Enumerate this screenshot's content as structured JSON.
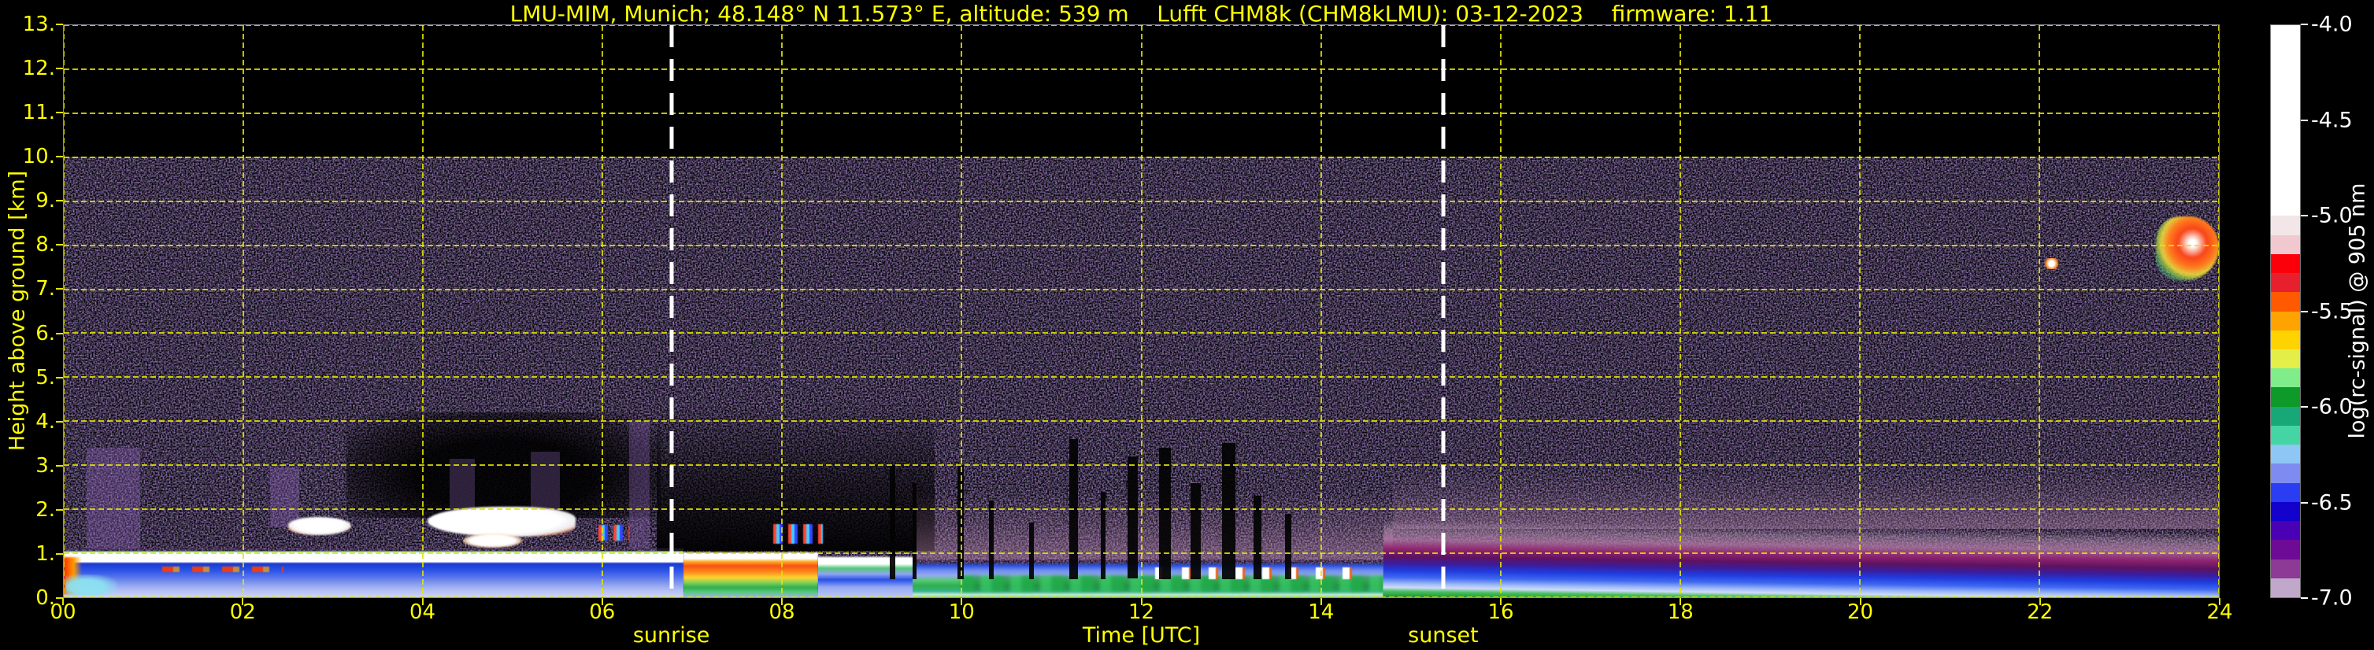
{
  "chart_data": {
    "type": "heatmap",
    "title": "LMU-MIM, Munich; 48.148° N 11.573° E, altitude: 539 m    Lufft CHM8k (CHM8kLMU): 03-12-2023    firmware: 1.11",
    "instrument": "Lufft CHM8k (CHM8kLMU)",
    "date": "03-12-2023",
    "firmware": "1.11",
    "x_axis": {
      "label": "Time [UTC]",
      "range": [
        0,
        24
      ],
      "tick_values": [
        0,
        2,
        4,
        6,
        8,
        10,
        12,
        14,
        16,
        18,
        20,
        22,
        24
      ],
      "tick_labels": [
        "00",
        "02",
        "04",
        "06",
        "08",
        "10",
        "12",
        "14",
        "16",
        "18",
        "20",
        "22",
        "24"
      ]
    },
    "y_axis": {
      "label": "Height above ground [km]",
      "range": [
        0,
        13
      ],
      "tick_values": [
        0,
        1,
        2,
        3,
        4,
        5,
        6,
        7,
        8,
        9,
        10,
        11,
        12,
        13
      ],
      "tick_labels": [
        "0.",
        "1.",
        "2.",
        "3.",
        "4.",
        "5.",
        "6.",
        "7.",
        "8.",
        "9.",
        "10.",
        "11.",
        "12.",
        "13."
      ]
    },
    "colorbar": {
      "label": "log(rc-signal) @ 905 nm",
      "range": [
        -7.0,
        -4.0
      ],
      "ticks": [
        {
          "value": -4.0,
          "label": "-4.0"
        },
        {
          "value": -4.5,
          "label": "-4.5"
        },
        {
          "value": -5.0,
          "label": "-5.0"
        },
        {
          "value": -5.5,
          "label": "-5.5"
        },
        {
          "value": -6.0,
          "label": "-6.0"
        },
        {
          "value": -6.5,
          "label": "-6.5"
        },
        {
          "value": -7.0,
          "label": "-7.0"
        }
      ],
      "segment_colors": [
        "#ffffff",
        "#ffffff",
        "#ffffff",
        "#ffffff",
        "#ffffff",
        "#ffffff",
        "#ffffff",
        "#ffffff",
        "#ffffff",
        "#ffffff",
        "#f2e6e8",
        "#f2c8d0",
        "#fb000a",
        "#e8202e",
        "#ff5a00",
        "#ffa300",
        "#ffd300",
        "#e4ee48",
        "#7fee8a",
        "#0e9a28",
        "#18a878",
        "#45d4a4",
        "#8ec6f6",
        "#7e8cf2",
        "#2a3df2",
        "#1202cc",
        "#4a00b4",
        "#6e0b96",
        "#8c3a96",
        "#bfa8ca"
      ]
    },
    "annotations": [
      {
        "name": "sunrise",
        "label": "sunrise",
        "time_utc": 6.77
      },
      {
        "name": "sunset",
        "label": "sunset",
        "time_utc": 15.36
      }
    ],
    "noise": {
      "ceiling_km": 10,
      "description": "purple-blue background noise speckle below 10 km; black (no data) above 10 km; bright multicolor speckle line at ground level"
    },
    "features": [
      {
        "name": "attenuation-shadow-early",
        "x0": 3.15,
        "x1": 6.65,
        "y0": 1.8,
        "y1": 4.2,
        "bg": "radial-gradient(ellipse at 50% 60%, rgba(0,0,0,0.92) 40%, rgba(0,0,0,0.55) 68%, rgba(0,0,0,0) 95%)"
      },
      {
        "name": "attenuation-shadow-fog",
        "x0": 6.6,
        "x1": 9.7,
        "y0": 1.05,
        "y1": 4.4,
        "bg": "linear-gradient(to top, rgba(0,0,0,0.95) 0%, rgba(0,0,0,0.6) 45%, rgba(0,0,0,0) 100%)"
      },
      {
        "name": "haze-speckle-day",
        "x0": 9.5,
        "x1": 14.8,
        "y0": 0.85,
        "y1": 2.4,
        "bg": "linear-gradient(to top, rgba(186,136,176,0.5) 0%, rgba(186,136,176,0.18) 55%, rgba(0,0,0,0) 100%)"
      },
      {
        "name": "haze-speckle-evening",
        "x0": 14.8,
        "x1": 24.05,
        "y0": 1.55,
        "y1": 2.9,
        "bg": "linear-gradient(to top, rgba(186,136,176,0.42) 0%, rgba(186,136,176,0.12) 60%, rgba(0,0,0,0) 100%)"
      },
      {
        "name": "virga-column-1",
        "x0": 0.25,
        "x1": 0.85,
        "y0": 1.1,
        "y1": 3.4,
        "bg": "rgba(135,95,175,0.38)"
      },
      {
        "name": "virga-column-2",
        "x0": 2.3,
        "x1": 2.62,
        "y0": 1.6,
        "y1": 2.95,
        "bg": "rgba(135,95,175,0.38)"
      },
      {
        "name": "virga-column-3",
        "x0": 4.3,
        "x1": 4.58,
        "y0": 2.0,
        "y1": 3.15,
        "bg": "rgba(135,95,175,0.32)"
      },
      {
        "name": "virga-column-4",
        "x0": 5.2,
        "x1": 5.52,
        "y0": 1.95,
        "y1": 3.3,
        "bg": "rgba(135,95,175,0.32)"
      },
      {
        "name": "virga-column-5",
        "x0": 6.3,
        "x1": 6.52,
        "y0": 1.1,
        "y1": 4.0,
        "bg": "rgba(135,95,175,0.35)"
      },
      {
        "name": "morning-boundary-layer",
        "x0": 0,
        "x1": 6.9,
        "y0": 0,
        "y1": 1.1,
        "bg": "linear-gradient(to bottom, rgba(120,50,120,0.45) 0%, rgba(120,50,120,0.12) 4%, #35c56a 6%, #dcf7e6 8%, #ffffff 10%, #ffffff 27%, #1b39cf 31%, #2d55e8 46%, #5c78ea 60%, #8da1f0 74%, #b3bff4 86%, #ccd4f8 100%)"
      },
      {
        "name": "fog-bank",
        "x0": 6.9,
        "x1": 8.4,
        "y0": 0,
        "y1": 1.02,
        "blur": 0.5,
        "bg": "linear-gradient(to bottom, #ffffff 0%, #ffffff 14%, #ffb02a 20%, #f85212 30%, #ff8b1e 44%, #ffd42e 56%, #8ed455 66%, #2fae4f 78%, #57c878 88%, #9db2f2 100%)"
      },
      {
        "name": "fog-tail",
        "x0": 8.4,
        "x1": 9.45,
        "y0": 0,
        "y1": 0.95,
        "bg": "linear-gradient(to bottom, rgba(255,255,255,0) 0%, #ffffff 6%, #ffffff 20%, #58c878 30%, #8ea6f0 44%, #2a50e8 58%, #96aaf2 76%, #bcc8f6 100%)"
      },
      {
        "name": "day-boundary-layer",
        "x0": 9.45,
        "x1": 14.7,
        "y0": 0,
        "y1": 0.88,
        "bg": "linear-gradient(to bottom, rgba(150,90,150,0.35) 0%, rgba(110,60,120,0.2) 9%, #2a52e0 18%, #6f8bee 30%, #96aaf2 43%, #57c878 56%, #2fae4f 70%, #35b48a 84%, #c2ead8 93%, #86d2a8 100%)"
      },
      {
        "name": "convective-green-tops",
        "x0": 10.0,
        "x1": 14.7,
        "y0": 0.12,
        "y1": 0.5,
        "blur": 2,
        "bg": "repeating-linear-gradient(90deg, rgba(34,168,74,0.95) 0px 16px, rgba(22,128,52,0.55) 16px 24px, rgba(52,190,96,0.85) 24px 38px)"
      },
      {
        "name": "cumulus-cloud-dots",
        "x0": 12.15,
        "x1": 14.5,
        "y0": 0.42,
        "y1": 0.68,
        "blur": 0.5,
        "bg": "repeating-linear-gradient(90deg, #ffffff 0px 9px, rgba(255,90,0,0.85) 9px 12px, rgba(255,255,255,0) 12px 34px)"
      },
      {
        "name": "evening-stratified-layers",
        "x0": 14.7,
        "x1": 24.05,
        "y0": 0,
        "y1": 1.75,
        "rot": 0.85,
        "bg": "linear-gradient(to bottom, rgba(196,156,190,0) 0%, rgba(196,156,190,0.45) 13%, rgba(186,126,172,0.75) 25%, #8f2470 37%, #5e1260 47%, #3a1d9e 56%, #1f3ce0 65%, #3f68f0 74%, #9db9f6 82%, #cfdbf9 87%, #48c060 92%, #2fa848 96%, #23843a 100%)"
      },
      {
        "name": "cloud-red-under-edge",
        "x0": 1.1,
        "x1": 2.45,
        "y0": 0.58,
        "y1": 0.7,
        "blur": 0.5,
        "bg": "repeating-linear-gradient(90deg, rgba(255,60,0,0.9) 0px 14px, rgba(255,170,0,0.7) 14px 22px, rgba(255,60,0,0) 22px 38px)"
      },
      {
        "name": "surface-flame-streak",
        "x0": 0,
        "x1": 0.2,
        "y0": 0.08,
        "y1": 0.92,
        "blur": 1,
        "bg": "linear-gradient(to right, #ff2a00 0%, #ff9c00 55%, rgba(255,200,0,0) 100%)"
      },
      {
        "name": "surface-cyan-patch",
        "x0": 0.02,
        "x1": 0.6,
        "y0": 0.05,
        "y1": 0.52,
        "bg": "radial-gradient(ellipse at 40% 60%, rgba(140,225,240,0.95) 40%, rgba(140,225,240,0) 80%)"
      },
      {
        "name": "cloud-0240",
        "x0": 2.5,
        "x1": 3.2,
        "y0": 1.42,
        "y1": 1.82,
        "blur": 1,
        "br": "48% 52% 55% 45%",
        "bg": "radial-gradient(ellipse at 50% 42%, #ffffff 52%, rgba(255,255,255,0.92) 68%, rgba(255,120,40,0.8) 78%, rgba(60,200,90,0.4) 87%, rgba(0,0,0,0) 95%)"
      },
      {
        "name": "cloud-0430",
        "x0": 4.05,
        "x1": 5.7,
        "y0": 1.38,
        "y1": 2.05,
        "blur": 1,
        "br": "55% 45% 40% 60%",
        "bg": "radial-gradient(ellipse at 45% 45%, #ffffff 58%, rgba(255,255,255,0.9) 72%, rgba(255,110,30,0.7) 82%, rgba(0,0,0,0) 93%)"
      },
      {
        "name": "cloud-0430-lower",
        "x0": 4.45,
        "x1": 5.1,
        "y0": 1.12,
        "y1": 1.45,
        "blur": 1,
        "br": "50%",
        "bg": "radial-gradient(ellipse, #ffffff 55%, rgba(255,160,60,0.6) 78%, rgba(0,0,0,0) 92%)"
      },
      {
        "name": "colorful-streaks-0605",
        "x0": 5.95,
        "x1": 6.3,
        "y0": 1.28,
        "y1": 1.64,
        "blur": 0.5,
        "bg": "repeating-linear-gradient(90deg, #ff4433 0px 4px, #44ccff 4px 8px, #3344ff 8px 12px, rgba(0,0,0,0) 12px 19px)"
      },
      {
        "name": "colorful-streaks-0800",
        "x0": 7.9,
        "x1": 8.45,
        "y0": 1.22,
        "y1": 1.66,
        "blur": 0.5,
        "bg": "repeating-linear-gradient(90deg, #ff4433 0px 4px, #44ccff 4px 8px, #3344ff 8px 12px, rgba(0,0,0,0) 12px 19px)"
      },
      {
        "name": "cirrus-patch",
        "x0": 23.3,
        "x1": 24.0,
        "y0": 7.2,
        "y1": 8.65,
        "blur": 1,
        "br": "45% 55% 60% 40%",
        "bg": "radial-gradient(ellipse at 58% 42%, #ffffff 7%, #f84418 28%, #ff7a1e 46%, rgba(242,222,60,0.9) 60%, rgba(80,200,90,0.6) 74%, rgba(90,130,230,0.35) 85%, rgba(0,0,0,0) 94%)"
      },
      {
        "name": "cirrus-speck",
        "x0": 22.05,
        "x1": 22.22,
        "y0": 7.45,
        "y1": 7.7,
        "bg": "radial-gradient(circle, #ffffff 30%, rgba(255,140,40,0.9) 60%, rgba(0,0,0,0) 85%)"
      },
      {
        "name": "dropout-column-1",
        "x0": 9.2,
        "x1": 9.26,
        "y0": 0.42,
        "y1": 3.0,
        "bg": "rgba(3,3,3,0.93)"
      },
      {
        "name": "dropout-column-2",
        "x0": 9.45,
        "x1": 9.5,
        "y0": 0.42,
        "y1": 2.6,
        "bg": "rgba(3,3,3,0.93)"
      },
      {
        "name": "dropout-column-3",
        "x0": 9.95,
        "x1": 10.02,
        "y0": 0.42,
        "y1": 3.0,
        "bg": "rgba(3,3,3,0.93)"
      },
      {
        "name": "dropout-column-4",
        "x0": 10.3,
        "x1": 10.36,
        "y0": 0.42,
        "y1": 2.2,
        "bg": "rgba(3,3,3,0.93)"
      },
      {
        "name": "dropout-column-5",
        "x0": 10.75,
        "x1": 10.8,
        "y0": 0.42,
        "y1": 1.7,
        "bg": "rgba(3,3,3,0.93)"
      },
      {
        "name": "dropout-column-6",
        "x0": 11.2,
        "x1": 11.29,
        "y0": 0.42,
        "y1": 3.6,
        "bg": "rgba(3,3,3,0.93)"
      },
      {
        "name": "dropout-column-7",
        "x0": 11.55,
        "x1": 11.6,
        "y0": 0.42,
        "y1": 2.4,
        "bg": "rgba(3,3,3,0.93)"
      },
      {
        "name": "dropout-column-8",
        "x0": 11.85,
        "x1": 11.96,
        "y0": 0.42,
        "y1": 3.2,
        "bg": "rgba(3,3,3,0.93)"
      },
      {
        "name": "dropout-column-9",
        "x0": 12.2,
        "x1": 12.33,
        "y0": 0.42,
        "y1": 3.4,
        "bg": "rgba(3,3,3,0.93)"
      },
      {
        "name": "dropout-column-10",
        "x0": 12.55,
        "x1": 12.66,
        "y0": 0.42,
        "y1": 2.6,
        "bg": "rgba(3,3,3,0.93)"
      },
      {
        "name": "dropout-column-11",
        "x0": 12.9,
        "x1": 13.05,
        "y0": 0.42,
        "y1": 3.5,
        "bg": "rgba(3,3,3,0.93)"
      },
      {
        "name": "dropout-column-12",
        "x0": 13.25,
        "x1": 13.34,
        "y0": 0.42,
        "y1": 2.3,
        "bg": "rgba(3,3,3,0.93)"
      },
      {
        "name": "dropout-column-13",
        "x0": 13.6,
        "x1": 13.67,
        "y0": 0.42,
        "y1": 1.9,
        "bg": "rgba(3,3,3,0.93)"
      }
    ]
  }
}
